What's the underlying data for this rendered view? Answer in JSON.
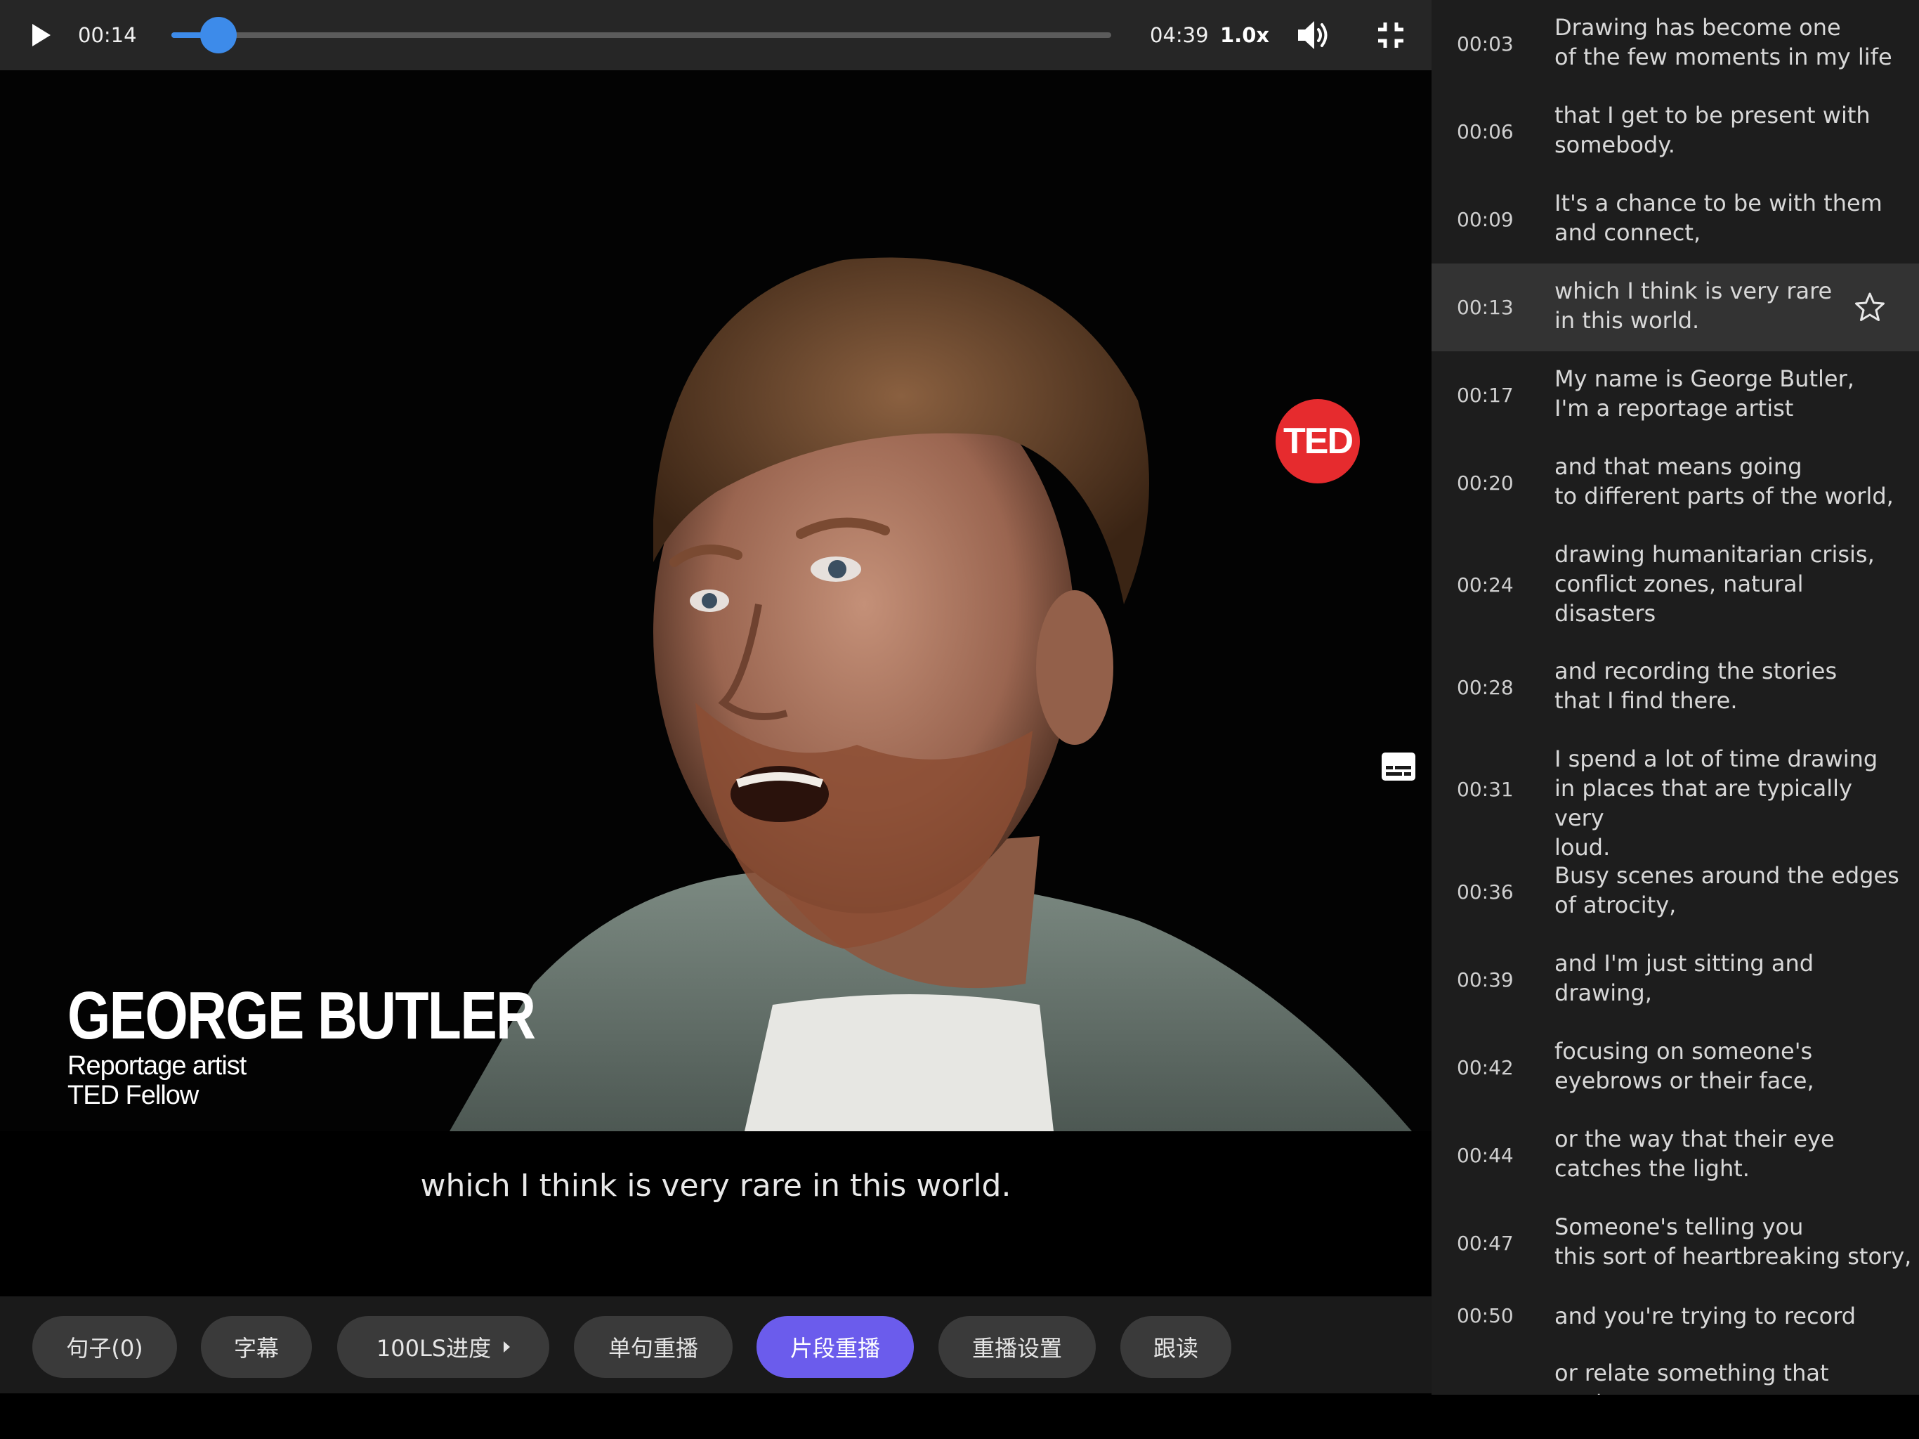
{
  "player": {
    "current_time": "00:14",
    "duration": "04:39",
    "speed": "1.0x",
    "progress_fraction": 0.05,
    "accent_color": "#3d8bea",
    "icons": [
      "play-icon",
      "volume-icon",
      "exit-fullscreen-icon",
      "subtitles-icon"
    ]
  },
  "video": {
    "logo_text": "TED",
    "speaker_name": "GEORGE BUTLER",
    "speaker_role": "Reportage artist",
    "speaker_title": "TED Fellow"
  },
  "subtitle": "which I think is very rare in this world.",
  "toolbar": {
    "active_color": "#6b5cec",
    "buttons": [
      {
        "label": "句子(0)"
      },
      {
        "label": "字幕"
      },
      {
        "label": "100LS进度"
      },
      {
        "label": "单句重播"
      },
      {
        "label": "片段重播"
      },
      {
        "label": "重播设置"
      },
      {
        "label": "跟读"
      }
    ]
  },
  "transcript": [
    {
      "time": "00:03",
      "line1": "Drawing has become one",
      "line2": "of the few moments in my life"
    },
    {
      "time": "00:06",
      "line1": "that I get to be present with",
      "line2": "somebody."
    },
    {
      "time": "00:09",
      "line1": "It's a chance to be with them",
      "line2": "and connect,"
    },
    {
      "time": "00:13",
      "line1": "which I think is very rare",
      "line2": "in this world."
    },
    {
      "time": "00:17",
      "line1": "My name is George Butler,",
      "line2": "I'm a reportage artist"
    },
    {
      "time": "00:20",
      "line1": "and that means going",
      "line2": "to different parts of the world,"
    },
    {
      "time": "00:24",
      "line1": "drawing humanitarian crisis,",
      "line2": "conflict zones, natural",
      "line3": "disasters"
    },
    {
      "time": "00:28",
      "line1": "and recording the stories",
      "line2": "that I find there."
    },
    {
      "time": "00:31",
      "line1": "I spend a lot of time drawing",
      "line2": "in places that are typically very",
      "line3": "loud."
    },
    {
      "time": "00:36",
      "line1": "Busy scenes around the edges",
      "line2": "of atrocity,"
    },
    {
      "time": "00:39",
      "line1": "and I'm just sitting and",
      "line2": "drawing,"
    },
    {
      "time": "00:42",
      "line1": "focusing on someone's",
      "line2": "eyebrows or their face,"
    },
    {
      "time": "00:44",
      "line1": "or the way that their eye",
      "line2": "catches the light."
    },
    {
      "time": "00:47",
      "line1": "Someone's telling you",
      "line2": "this sort of heartbreaking story,"
    },
    {
      "time": "00:50",
      "line1": "and you're trying to record"
    },
    {
      "line1": "or relate something that you've"
    }
  ]
}
